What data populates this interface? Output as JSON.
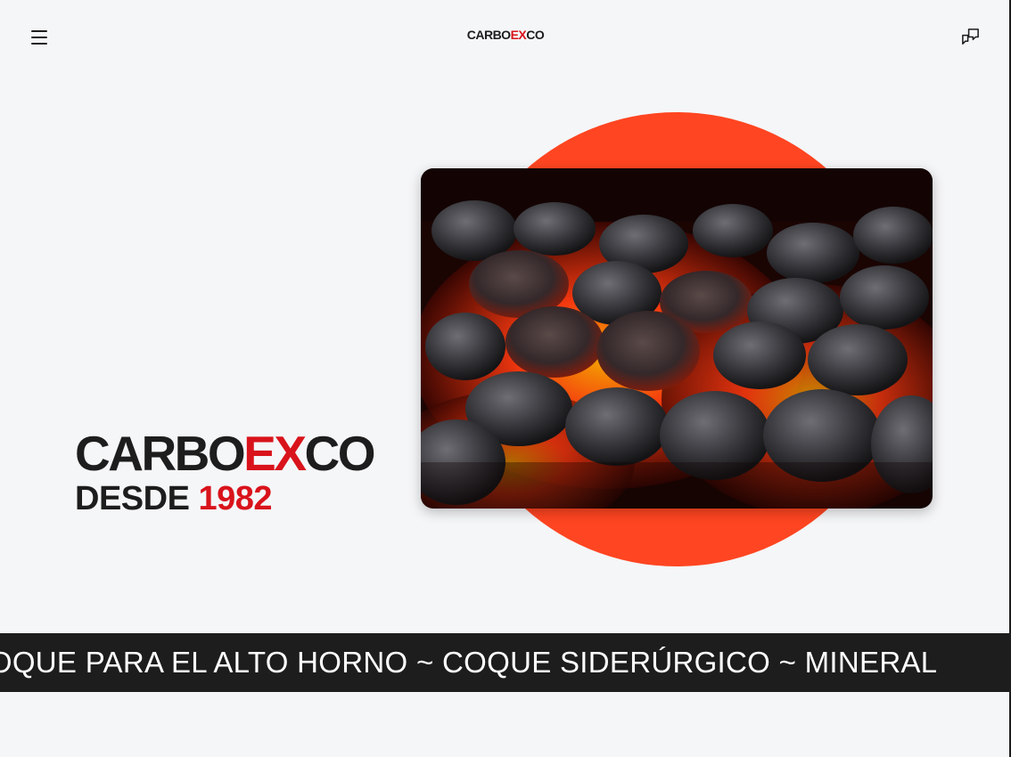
{
  "header": {
    "menu_icon": "hamburger-menu-icon",
    "logo": {
      "part1": "CARBO",
      "part2": "EX",
      "part3": "CO"
    },
    "chat_icon": "chat-bubbles-icon"
  },
  "hero": {
    "title_line1": {
      "part1": "CARBO",
      "part2": "EX",
      "part3": "CO"
    },
    "title_line2": {
      "text": "DESDE",
      "year": "1982"
    },
    "image_subject": "glowing-coal-briquettes",
    "colors": {
      "accent_red": "#d9131b",
      "circle_orange": "#ff4521",
      "dark": "#1d1d1d",
      "background": "#f5f6f8"
    }
  },
  "marquee": {
    "text": "TIVO ~ COQUE PARA EL ALTO HORNO ~ COQUE SIDERÚRGICO ~ MINERAL"
  }
}
